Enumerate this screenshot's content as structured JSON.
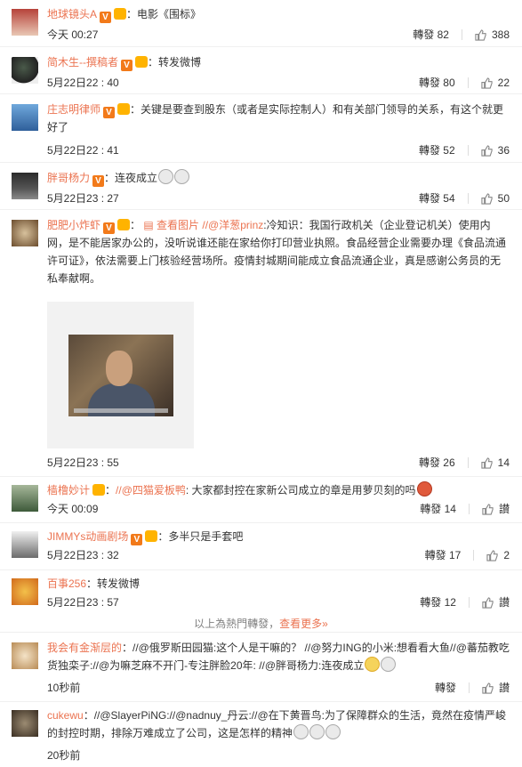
{
  "comments": [
    {
      "user": "地球镜头A",
      "text": "：电影《围标》",
      "time": "今天 00:27",
      "repost": "轉發 82",
      "likes": "388"
    },
    {
      "user": "简木生--撰稿者",
      "text": "：转发微博",
      "time": "5月22日22 : 40",
      "repost": "轉發 80",
      "likes": "22"
    },
    {
      "user": "庄志明律师",
      "text": "：关键是要查到股东（或者是实际控制人）和有关部门领导的关系，有这个就更好了",
      "time": "5月22日22 : 41",
      "repost": "轉發 52",
      "likes": "36"
    },
    {
      "user": "胖哥杨力",
      "text": "：连夜成立",
      "time": "5月22日23 : 27",
      "repost": "轉發 54",
      "likes": "50"
    },
    {
      "user": "肥肥小炸虾",
      "view_pic": "查看图片",
      "mention": "//@洋葱prinz",
      "text": ":冷知识：我国行政机关（企业登记机关）使用内网，是不能居家办公的，没听说谁还能在家给你打印营业执照。食品经营企业需要办理《食品流通许可证》，依法需要上门核验经营场所。疫情封城期间能成立食品流通企业，真是感谢公务员的无私奉献啊。",
      "time": "5月22日23 : 55",
      "repost": "轉發 26",
      "likes": "14"
    },
    {
      "user": "樯橹妙计",
      "mention": "//@四猫爱板鸭",
      "text": ": 大家都封控在家新公司成立的章是用萝贝刻的吗",
      "time": "今天 00:09",
      "repost": "轉發 14",
      "likes": "讃"
    },
    {
      "user": "JIMMYs动画剧场",
      "text": "：多半只是手套吧",
      "time": "5月22日23 : 32",
      "repost": "轉發 17",
      "likes": "2"
    },
    {
      "user": "百事256",
      "text": "：转发微博",
      "time": "5月22日23 : 57",
      "repost": "轉發 12",
      "likes": "讃"
    },
    {
      "user": "我会有金渐层的",
      "text": "：//@俄罗斯田园猫:这个人是干嘛的？ //@努力ING的小米:想看看大鱼//@蕃茄教吃货独栾子://@为嘛芝麻不开门-专注胖脸20年: //@胖哥杨力:连夜成立",
      "time": "10秒前",
      "repost": "轉發",
      "likes": "讃"
    },
    {
      "user": "cukewu",
      "text": "：//@SlayerPiNG://@nadnuy_丹云://@在下黄晋鸟:为了保障群众的生活，竟然在疫情严峻的封控时期，排除万难成立了公司，这是怎样的精神",
      "time": "20秒前",
      "repost": "轉發",
      "likes": "讃"
    }
  ],
  "hot_divider": {
    "text": "以上為熱門轉發，",
    "more": "查看更多»"
  },
  "colors": {
    "username": "#eb7350",
    "text": "#333333",
    "meta": "#808080"
  }
}
